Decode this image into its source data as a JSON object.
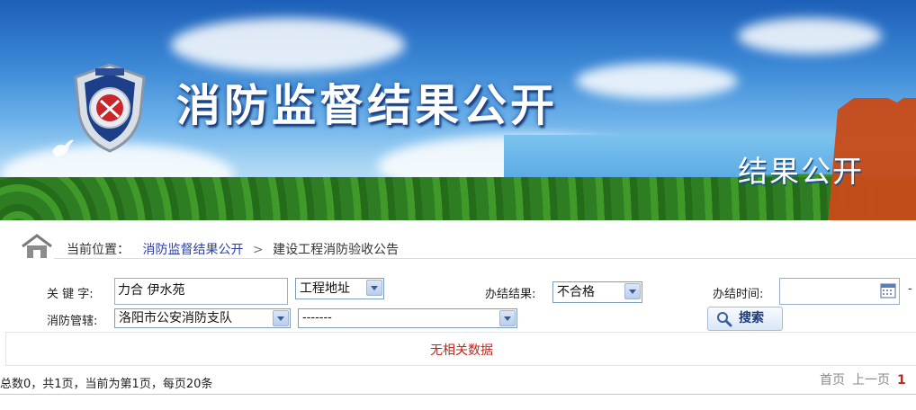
{
  "banner": {
    "title": "消防监督结果公开",
    "subtitle": "结果公开"
  },
  "breadcrumb": {
    "prefix": "当前位置：",
    "items": [
      "消防监督结果公开",
      "建设工程消防验收公告"
    ],
    "separator": ">"
  },
  "form": {
    "keyword_label": "关 键 字:",
    "keyword_value": "力合 伊水苑",
    "keyword_type": "工程地址",
    "result_label": "办结结果:",
    "result_value": "不合格",
    "time_label": "办结时间:",
    "time_value": "",
    "time_suffix": "-",
    "dept_label": "消防管辖:",
    "dept_value": "洛阳市公安消防支队",
    "subdept_value": "-------",
    "search_label": "搜索"
  },
  "results": {
    "empty_message": "无相关数据"
  },
  "pager": {
    "summary": "总数0，共1页，当前为第1页，每页20条",
    "first": "首页",
    "prev": "上一页",
    "current": "1"
  },
  "icons": {
    "home": "home-icon",
    "calendar": "calendar-icon",
    "search": "magnifier-icon",
    "emblem": "fire-emblem-icon",
    "dove": "dove-icon"
  },
  "colors": {
    "link": "#2b3ea8",
    "alert": "#c4241b"
  }
}
